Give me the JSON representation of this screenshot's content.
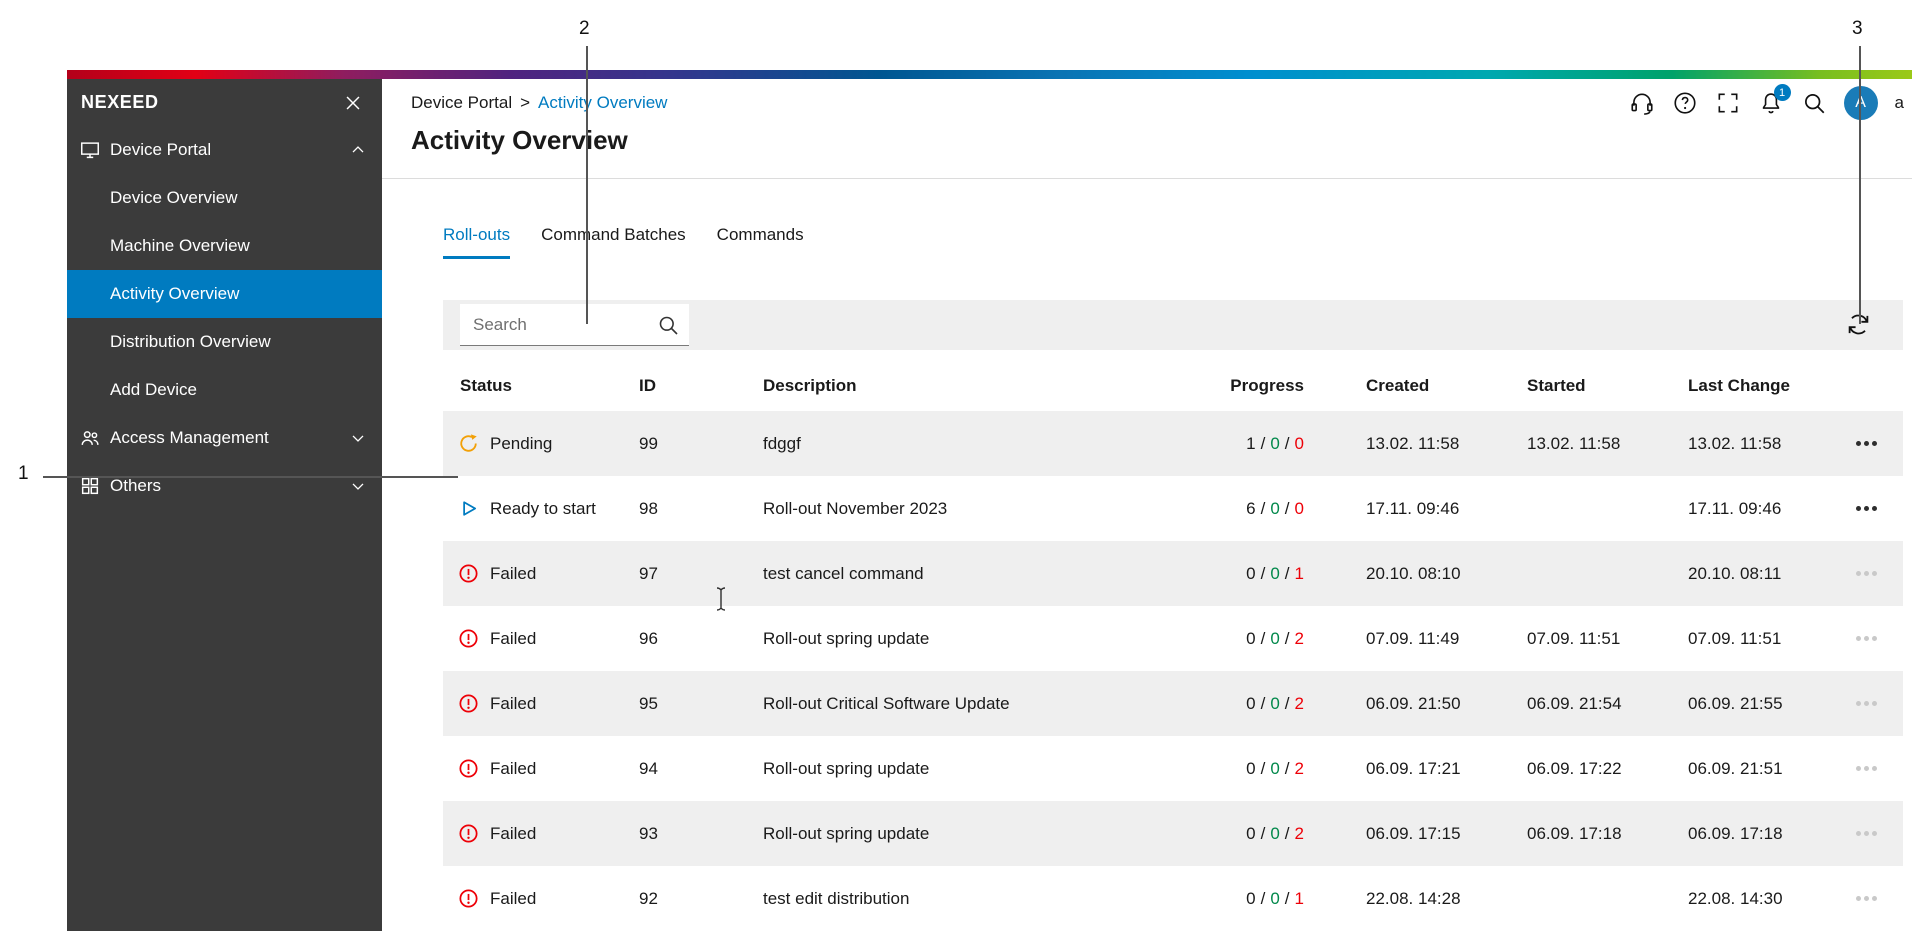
{
  "annotations": {
    "callouts": [
      {
        "label": "1"
      },
      {
        "label": "2"
      },
      {
        "label": "3"
      }
    ]
  },
  "colors": {
    "accent_blue": "#007bc0",
    "sidebar_bg": "#3b3b3b",
    "row_alt_gray": "#efefef",
    "success_green": "#00884a",
    "error_red": "#ed0007",
    "pending_orange": "#f2a007"
  },
  "sidebar": {
    "brand": "NEXEED",
    "sections": [
      {
        "label": "Device Portal",
        "expanded": true,
        "items": [
          {
            "label": "Device Overview",
            "selected": false
          },
          {
            "label": "Machine Overview",
            "selected": false
          },
          {
            "label": "Activity Overview",
            "selected": true
          },
          {
            "label": "Distribution Overview",
            "selected": false
          },
          {
            "label": "Add Device",
            "selected": false
          }
        ]
      },
      {
        "label": "Access Management",
        "expanded": false
      },
      {
        "label": "Others",
        "expanded": false
      }
    ]
  },
  "topbar": {
    "breadcrumb": {
      "parent": "Device Portal",
      "separator": ">",
      "current": "Activity Overview"
    },
    "notification_count": "1",
    "avatar_initial": "A",
    "clipped_text": "a"
  },
  "page": {
    "title": "Activity Overview"
  },
  "tabs": [
    {
      "label": "Roll-outs",
      "active": true
    },
    {
      "label": "Command Batches",
      "active": false
    },
    {
      "label": "Commands",
      "active": false
    }
  ],
  "toolbar": {
    "search_placeholder": "Search"
  },
  "table": {
    "progress_separator": "/",
    "columns": [
      "Status",
      "ID",
      "Description",
      "Progress",
      "Created",
      "Started",
      "Last Change"
    ],
    "rows": [
      {
        "status": "Pending",
        "status_type": "pending",
        "id": "99",
        "description": "fdggf",
        "progress": [
          "1",
          "0",
          "0"
        ],
        "created": "13.02. 11:58",
        "started": "13.02. 11:58",
        "last_change": "13.02. 11:58",
        "actions_enabled": true
      },
      {
        "status": "Ready to start",
        "status_type": "ready",
        "id": "98",
        "description": "Roll-out November 2023",
        "progress": [
          "6",
          "0",
          "0"
        ],
        "created": "17.11. 09:46",
        "started": "",
        "last_change": "17.11. 09:46",
        "actions_enabled": true
      },
      {
        "status": "Failed",
        "status_type": "failed",
        "id": "97",
        "description": "test cancel command",
        "progress": [
          "0",
          "0",
          "1"
        ],
        "created": "20.10. 08:10",
        "started": "",
        "last_change": "20.10. 08:11",
        "actions_enabled": false
      },
      {
        "status": "Failed",
        "status_type": "failed",
        "id": "96",
        "description": "Roll-out spring update",
        "progress": [
          "0",
          "0",
          "2"
        ],
        "created": "07.09. 11:49",
        "started": "07.09. 11:51",
        "last_change": "07.09. 11:51",
        "actions_enabled": false
      },
      {
        "status": "Failed",
        "status_type": "failed",
        "id": "95",
        "description": "Roll-out Critical Software Update",
        "progress": [
          "0",
          "0",
          "2"
        ],
        "created": "06.09. 21:50",
        "started": "06.09. 21:54",
        "last_change": "06.09. 21:55",
        "actions_enabled": false
      },
      {
        "status": "Failed",
        "status_type": "failed",
        "id": "94",
        "description": "Roll-out spring update",
        "progress": [
          "0",
          "0",
          "2"
        ],
        "created": "06.09. 17:21",
        "started": "06.09. 17:22",
        "last_change": "06.09. 21:51",
        "actions_enabled": false
      },
      {
        "status": "Failed",
        "status_type": "failed",
        "id": "93",
        "description": "Roll-out spring update",
        "progress": [
          "0",
          "0",
          "2"
        ],
        "created": "06.09. 17:15",
        "started": "06.09. 17:18",
        "last_change": "06.09. 17:18",
        "actions_enabled": false
      },
      {
        "status": "Failed",
        "status_type": "failed",
        "id": "92",
        "description": "test edit distribution",
        "progress": [
          "0",
          "0",
          "1"
        ],
        "created": "22.08. 14:28",
        "started": "",
        "last_change": "22.08. 14:30",
        "actions_enabled": false
      }
    ]
  }
}
